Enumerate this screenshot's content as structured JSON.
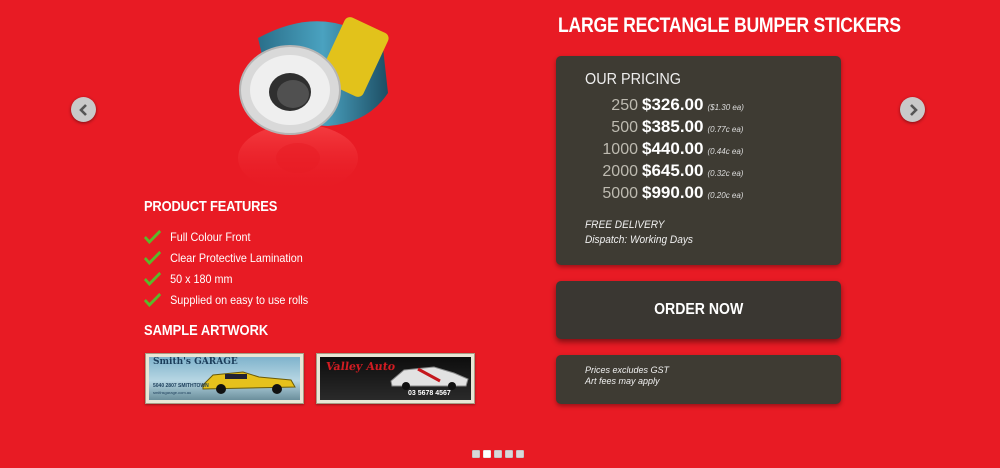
{
  "title": "LARGE RECTANGLE BUMPER STICKERS",
  "features": {
    "heading": "PRODUCT FEATURES",
    "items": [
      "Full Colour Front",
      "Clear Protective Lamination",
      "50 x 180 mm",
      "Supplied on easy to use rolls"
    ]
  },
  "samples": {
    "heading": "SAMPLE ARTWORK",
    "items": [
      {
        "name": "Smith's GARAGE",
        "line": "5040 2807 SMITHTOWN",
        "url": "smithsgarage.com.au"
      },
      {
        "name": "Valley Auto",
        "phone": "03 5678 4567"
      }
    ]
  },
  "pricing": {
    "heading": "OUR PRICING",
    "rows": [
      {
        "qty": "250",
        "price": "$326.00",
        "each": "($1.30 ea)"
      },
      {
        "qty": "500",
        "price": "$385.00",
        "each": "(0.77c ea)"
      },
      {
        "qty": "1000",
        "price": "$440.00",
        "each": "(0.44c ea)"
      },
      {
        "qty": "2000",
        "price": "$645.00",
        "each": "(0.32c ea)"
      },
      {
        "qty": "5000",
        "price": "$990.00",
        "each": "(0.20c ea)"
      }
    ],
    "delivery": "FREE DELIVERY",
    "dispatch": "Dispatch: Working Days"
  },
  "order_label": "ORDER NOW",
  "notes": {
    "gst": "Prices excludes GST",
    "art": "Art fees may apply"
  },
  "carousel": {
    "slides": 5,
    "active": 2
  },
  "colors": {
    "background": "#e81b24",
    "panel": "#3e3b33",
    "check": "#5cb82a"
  },
  "icons": {
    "prev": "chevron-left-icon",
    "next": "chevron-right-icon",
    "feature": "checkmark-icon"
  }
}
